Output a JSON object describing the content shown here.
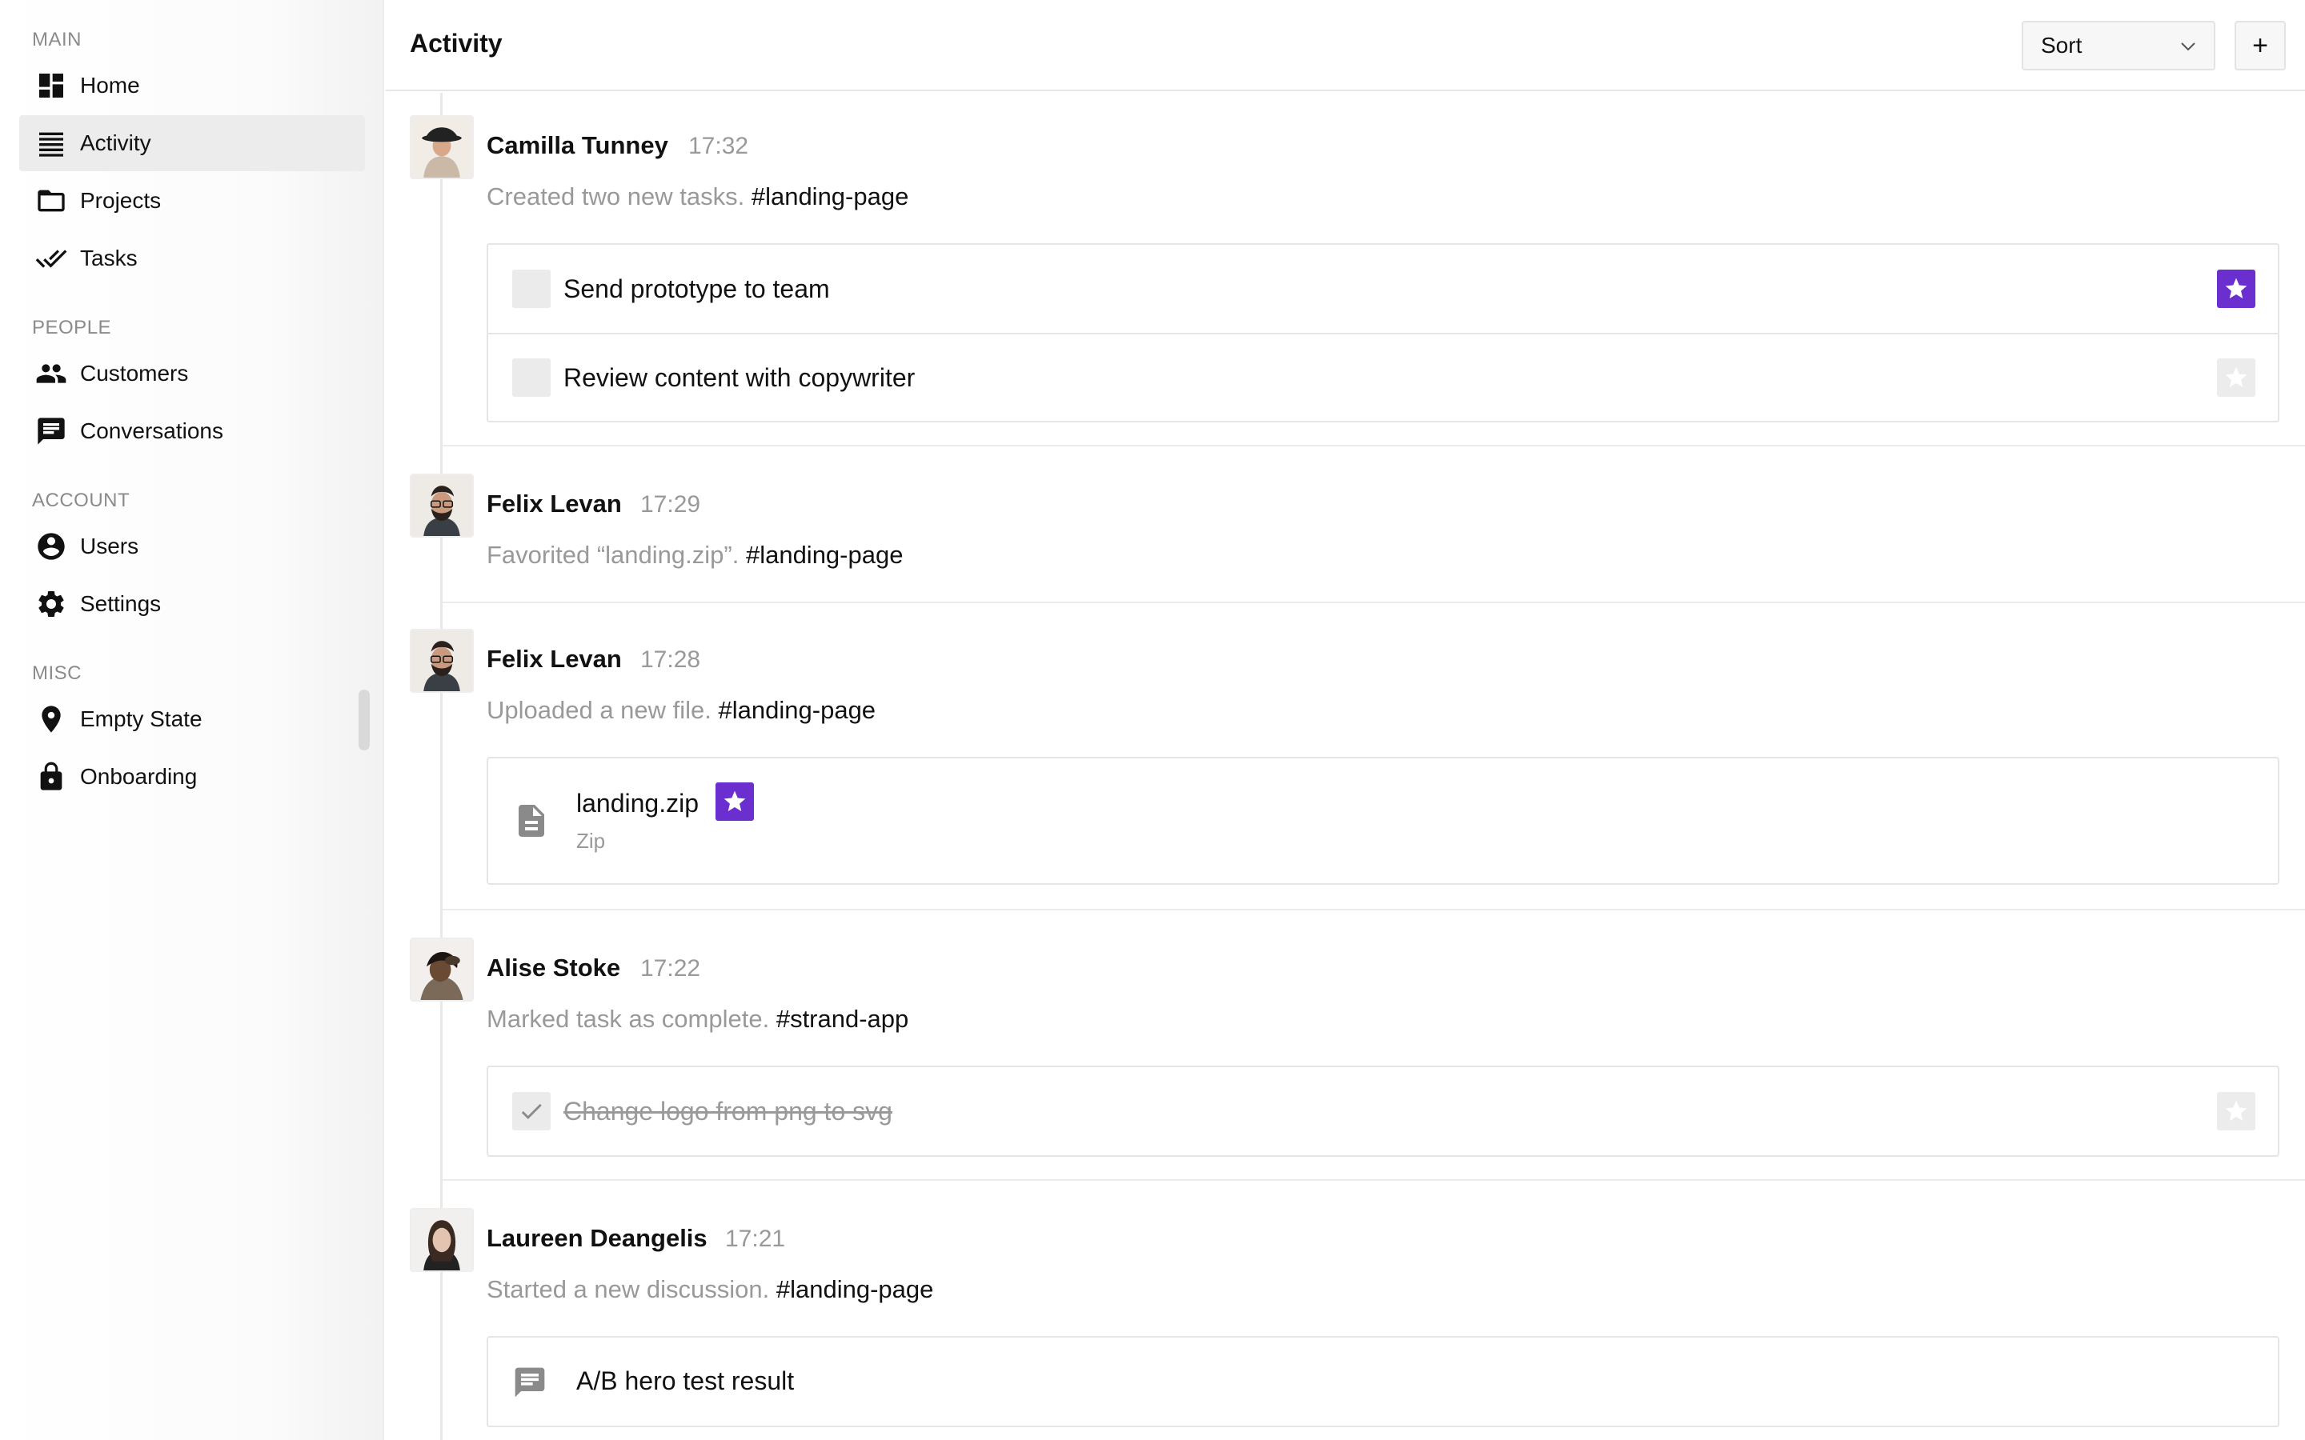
{
  "sidebar": {
    "sections": [
      {
        "title": "MAIN"
      },
      {
        "title": "PEOPLE"
      },
      {
        "title": "ACCOUNT"
      },
      {
        "title": "MISC"
      }
    ],
    "items": [
      {
        "label": "Home",
        "icon": "dashboard-icon"
      },
      {
        "label": "Activity",
        "icon": "list-icon",
        "active": true
      },
      {
        "label": "Projects",
        "icon": "folder-icon"
      },
      {
        "label": "Tasks",
        "icon": "double-check-icon"
      },
      {
        "label": "Customers",
        "icon": "people-icon"
      },
      {
        "label": "Conversations",
        "icon": "chat-icon"
      },
      {
        "label": "Users",
        "icon": "account-circle-icon"
      },
      {
        "label": "Settings",
        "icon": "gear-icon"
      },
      {
        "label": "Empty State",
        "icon": "location-pin-icon"
      },
      {
        "label": "Onboarding",
        "icon": "lock-icon"
      }
    ]
  },
  "header": {
    "title": "Activity",
    "sort_label": "Sort",
    "add_label": "+"
  },
  "colors": {
    "accent": "#6b2fcf",
    "muted_text": "#999999",
    "active_bg": "#ececec"
  },
  "feed": [
    {
      "name": "Camilla Tunney",
      "time": "17:32",
      "action": "Created two new tasks.",
      "tag": "#landing-page",
      "tasks": [
        {
          "text": "Send prototype to team",
          "starred": true,
          "done": false
        },
        {
          "text": "Review content with copywriter",
          "starred": false,
          "done": false
        }
      ]
    },
    {
      "name": "Felix Levan",
      "time": "17:29",
      "action": "Favorited “landing.zip”.",
      "tag": "#landing-page"
    },
    {
      "name": "Felix Levan",
      "time": "17:28",
      "action": "Uploaded a new file.",
      "tag": "#landing-page",
      "file": {
        "name": "landing.zip",
        "type": "Zip",
        "starred": true
      }
    },
    {
      "name": "Alise Stoke",
      "time": "17:22",
      "action": "Marked task as complete.",
      "tag": "#strand-app",
      "tasks": [
        {
          "text": "Change logo from png to svg",
          "starred": false,
          "done": true
        }
      ]
    },
    {
      "name": "Laureen Deangelis",
      "time": "17:21",
      "action": "Started a new discussion.",
      "tag": "#landing-page",
      "discussion": {
        "title": "A/B hero test result"
      }
    }
  ]
}
